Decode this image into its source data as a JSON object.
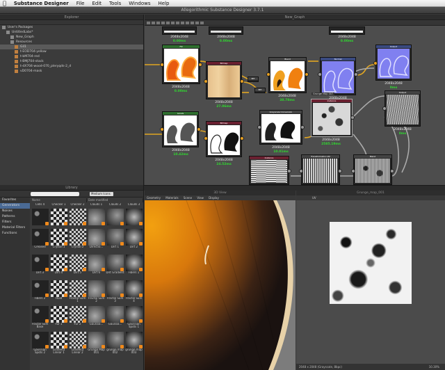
{
  "menubar": {
    "apple": "",
    "app_name": "Substance Designer",
    "items": [
      "File",
      "Edit",
      "Tools",
      "Windows",
      "Help"
    ]
  },
  "window_title": "Allegorithmic Substance Designer 3.7.1",
  "explorer": {
    "title": "Explorer",
    "tree": [
      {
        "label": "User's Packages",
        "indent": 0
      },
      {
        "label": "UntitledLabs*",
        "indent": 1
      },
      {
        "label": "New_Graph",
        "indent": 2
      },
      {
        "label": "Resources",
        "indent": 2
      },
      {
        "label": "Gil1",
        "indent": 3,
        "selected": true
      },
      {
        "label": "t-EOD704-yellow",
        "indent": 3
      },
      {
        "label": "t-bM704-red",
        "indent": 3
      },
      {
        "label": "t-BMJ704-stack",
        "indent": 3
      },
      {
        "label": "t-dX704-wood-070_pleryqds-2_d",
        "indent": 3
      },
      {
        "label": "vD0704-mask",
        "indent": 3
      }
    ]
  },
  "graph": {
    "title": "New_Graph",
    "nodes": {
      "n_top1": {
        "res": "2048x2048",
        "time": "0.00ms"
      },
      "n_top2": {
        "res": "2048x2048",
        "time": "0.00ms"
      },
      "n_top3": {
        "res": "2048x2048",
        "time": "0.00ms"
      },
      "n_fill": {
        "title": "Fill",
        "res": "2048x2048",
        "time": "0.00ms"
      },
      "n_bitmap": {
        "title": "Bitmap",
        "res": "2048x2048",
        "time": "27.06ms"
      },
      "n_blend": {
        "title": "Blend",
        "res": "2048x2048",
        "time": "38.78ms"
      },
      "n_normal": {
        "title": "Normal",
        "res": "2048x2048",
        "time": "0.00ms"
      },
      "n_output1": {
        "title": "Output",
        "res": "2048x2048",
        "time": "0ms"
      },
      "n_levels": {
        "title": "Levels",
        "res": "2048x2048",
        "time": "10.42ms"
      },
      "n_bitmap2": {
        "title": "Bitmap",
        "res": "2048x2048",
        "time": "24.52ms"
      },
      "n_grayscale": {
        "title": "Grayscale Conversion",
        "res": "2048x2048",
        "time": "10.01ms"
      },
      "n_instance": {
        "title": "Instance",
        "res": "2048x2048",
        "time": "2585.19ms"
      },
      "n_output2": {
        "title": "Output",
        "res": "2048x2048",
        "time": "0ms"
      },
      "n_instance2": {
        "title": "Instance",
        "res": "2048x2048",
        "time": "14.29ms"
      },
      "n_transform": {
        "title": "Transformation 2D",
        "res": "2048x2048",
        "time": "26.30ms"
      },
      "n_blend2": {
        "title": "Blend",
        "res": "2048x2048",
        "time": "19.41ms"
      }
    },
    "tooltip": "Grunge Map 007",
    "blend_labels": [
      "BIT",
      "BIT"
    ]
  },
  "library": {
    "title": "Library",
    "search_placeholder": "",
    "view_mode": "Medium Icons",
    "columns": [
      "Name",
      "Date modified"
    ],
    "categories": [
      {
        "label": "Favorites"
      },
      {
        "label": "Generators",
        "selected": true
      },
      {
        "label": "Noises"
      },
      {
        "label": "Patterns"
      },
      {
        "label": "Filters"
      },
      {
        "label": "Material Filters"
      },
      {
        "label": "Functions"
      }
    ],
    "items": [
      {
        "label": "Cells 4"
      },
      {
        "label": "Checker 1"
      },
      {
        "label": "Checker 2"
      },
      {
        "label": "Clouds 1"
      },
      {
        "label": "Clouds 2"
      },
      {
        "label": "Clouds 3"
      },
      {
        "label": "Creased"
      },
      {
        "label": "Crystal 1"
      },
      {
        "label": "Crystal 2"
      },
      {
        "label": "Directio..."
      },
      {
        "label": "Dirt 1"
      },
      {
        "label": "Dirt 2"
      },
      {
        "label": "Dirt 3"
      },
      {
        "label": "Dirt 4"
      },
      {
        "label": "Dirt 5"
      },
      {
        "label": "Dirt 6"
      },
      {
        "label": "Dirt Gradient"
      },
      {
        "label": "Fibers 1"
      },
      {
        "label": "Fibers 2"
      },
      {
        "label": "Fluid"
      },
      {
        "label": "Fractal Sum 1"
      },
      {
        "label": "Fractal Sum 2"
      },
      {
        "label": "Fractal Sum 3"
      },
      {
        "label": "Fractal Sum 4"
      },
      {
        "label": "Fractal Sum Base"
      },
      {
        "label": "Fur 1"
      },
      {
        "label": "Fur 2"
      },
      {
        "label": "Gaussia..."
      },
      {
        "label": "Gaussia..."
      },
      {
        "label": "Gaussian Spots 1"
      },
      {
        "label": "Gaussian Spots 2"
      },
      {
        "label": "Gradient Linear 1"
      },
      {
        "label": "Gradient Linear 2"
      },
      {
        "label": "Grunge Map 001"
      },
      {
        "label": "grunge map 002"
      },
      {
        "label": "grunge map 003"
      }
    ]
  },
  "view3d": {
    "title": "3D View",
    "menu": [
      "Geometry",
      "Materials",
      "Scene",
      "View",
      "Display"
    ]
  },
  "view2d": {
    "title": "Grunge_map_001",
    "status": "2048 x 2048 (Grayscale, 8bpc)",
    "zoom": "10.30%",
    "uv_label": "UV"
  },
  "colors": {
    "accent_orange": "#e8a020",
    "time_green": "#30d830",
    "selection_blue": "#4a6a95"
  }
}
